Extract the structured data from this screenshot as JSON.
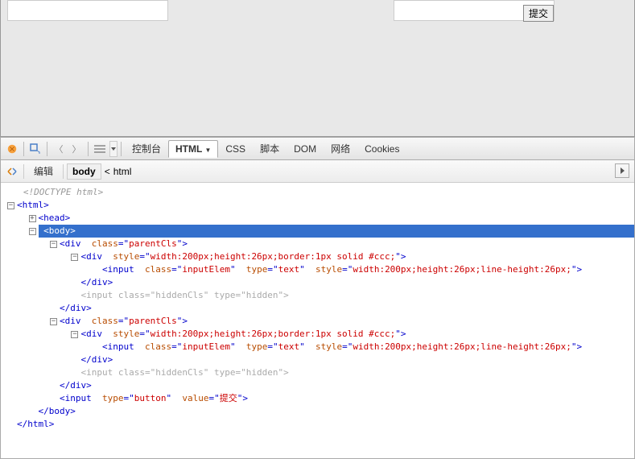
{
  "page": {
    "submit_label": "提交"
  },
  "toolbar": {
    "tabs": [
      "控制台",
      "HTML",
      "CSS",
      "脚本",
      "DOM",
      "网络",
      "Cookies"
    ],
    "active_tab_index": 1
  },
  "subbar": {
    "edit_label": "编辑",
    "breadcrumb": [
      "body",
      "html"
    ],
    "breadcrumb_separator": "<"
  },
  "tree": {
    "doctype": "<!DOCTYPE html>",
    "lines": [
      {
        "indent": 0,
        "twisty": "-",
        "html": "<html>"
      },
      {
        "indent": 1,
        "twisty": "+",
        "html": "<head>"
      },
      {
        "indent": 1,
        "twisty": "-",
        "selected": true,
        "html": "<body>"
      },
      {
        "indent": 2,
        "twisty": "-",
        "html": "<div class=\"parentCls\">"
      },
      {
        "indent": 3,
        "twisty": "-",
        "html": "<div style=\"width:200px;height:26px;border:1px solid #ccc;\">"
      },
      {
        "indent": 4,
        "twisty": "",
        "html": "<input class=\"inputElem\" type=\"text\" style=\"width:200px;height:26px;line-height:26px;\">"
      },
      {
        "indent": 3,
        "twisty": "",
        "html": "</div>"
      },
      {
        "indent": 3,
        "twisty": "",
        "dim": true,
        "html": "<input class=\"hiddenCls\" type=\"hidden\">"
      },
      {
        "indent": 2,
        "twisty": "",
        "html": "</div>"
      },
      {
        "indent": 2,
        "twisty": "-",
        "html": "<div class=\"parentCls\">"
      },
      {
        "indent": 3,
        "twisty": "-",
        "html": "<div style=\"width:200px;height:26px;border:1px solid #ccc;\">"
      },
      {
        "indent": 4,
        "twisty": "",
        "html": "<input class=\"inputElem\" type=\"text\" style=\"width:200px;height:26px;line-height:26px;\">"
      },
      {
        "indent": 3,
        "twisty": "",
        "html": "</div>"
      },
      {
        "indent": 3,
        "twisty": "",
        "dim": true,
        "html": "<input class=\"hiddenCls\" type=\"hidden\">"
      },
      {
        "indent": 2,
        "twisty": "",
        "html": "</div>"
      },
      {
        "indent": 2,
        "twisty": "",
        "html": "<input type=\"button\" value=\"提交\">"
      },
      {
        "indent": 1,
        "twisty": "",
        "html": "</body>"
      },
      {
        "indent": 0,
        "twisty": "",
        "html": "</html>"
      }
    ]
  }
}
